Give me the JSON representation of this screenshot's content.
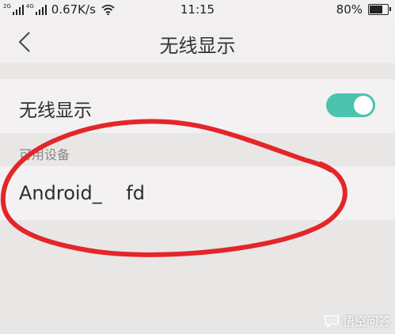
{
  "status_bar": {
    "network_labels": [
      "2G",
      "4G"
    ],
    "speed": "0.67K/s",
    "time": "11:15",
    "battery": "80%",
    "battery_level": 0.8
  },
  "header": {
    "title": "无线显示"
  },
  "settings": {
    "wireless_display_label": "无线显示",
    "wireless_display_enabled": true
  },
  "devices": {
    "section_title": "可用设备",
    "items": [
      {
        "name": "Android_    fd"
      }
    ]
  },
  "watermark": {
    "text": "悟空问答"
  },
  "colors": {
    "accent": "#4bc3ad",
    "annotation": "#e3262a",
    "background": "#e9e6e6",
    "row": "#f3f1f1"
  }
}
